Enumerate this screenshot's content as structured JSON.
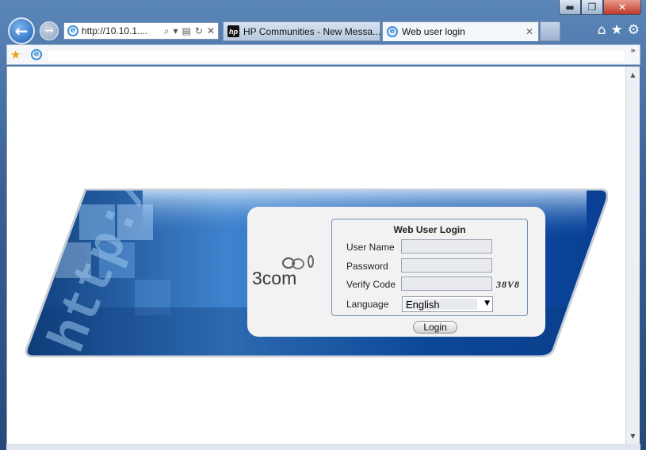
{
  "browser": {
    "address_url": "http://10.10.1....",
    "tabs": [
      {
        "label": "HP Communities - New Messa..."
      },
      {
        "label": "Web user login",
        "close": "✕"
      }
    ],
    "favorites_chevron": "»"
  },
  "window_controls": {
    "minimize": "▬",
    "maximize": "❐",
    "close": "✕"
  },
  "login": {
    "title": "Web User Login",
    "user_name_label": "User Name",
    "password_label": "Password",
    "verify_code_label": "Verify Code",
    "verify_code_value": "38V8",
    "language_label": "Language",
    "language_selected": "English",
    "login_button": "Login"
  },
  "logo": {
    "text": "3com"
  },
  "banner": {
    "overlay_text": "http://ww"
  },
  "colors": {
    "accent": "#1a5fb4",
    "banner_blue": "#0d4fa8",
    "panel": "#f2f2f2"
  }
}
